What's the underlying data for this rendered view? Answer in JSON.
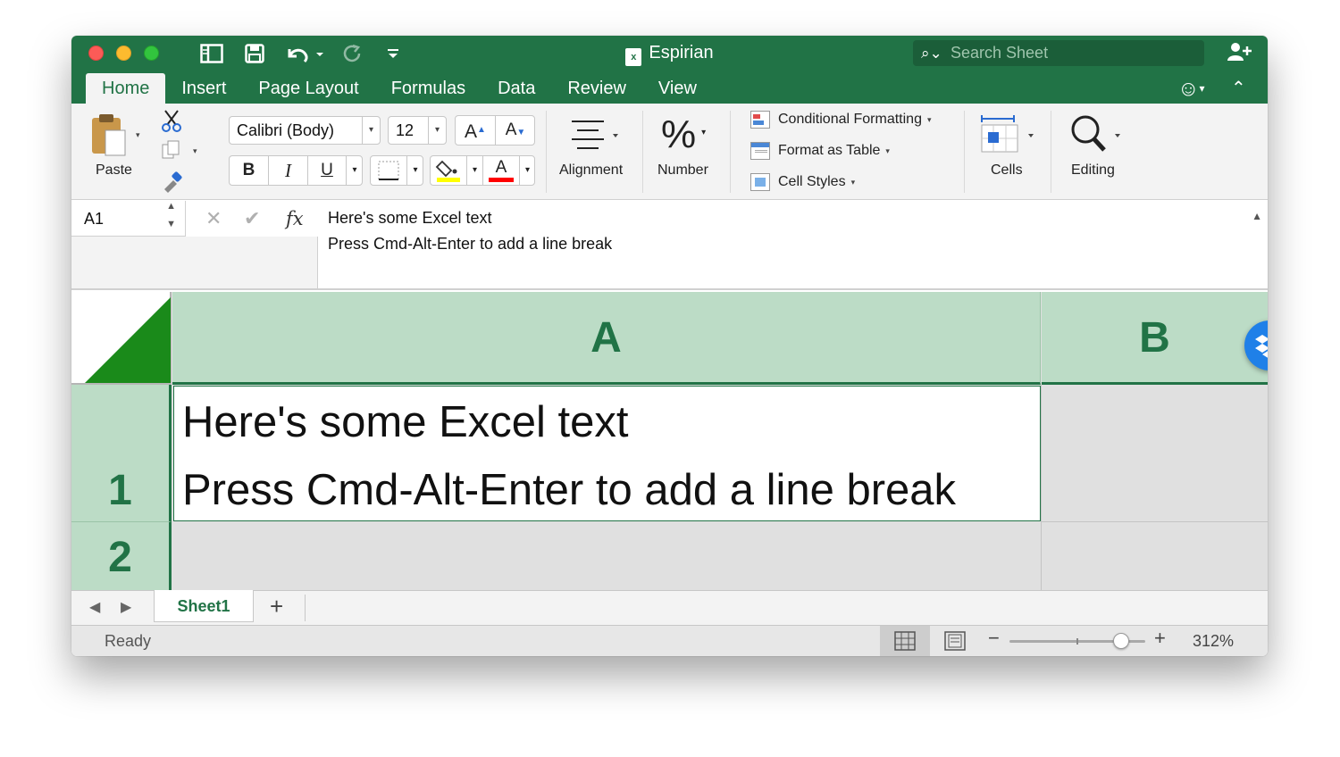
{
  "window": {
    "title": "Espirian"
  },
  "search": {
    "placeholder": "Search Sheet"
  },
  "tabs": [
    "Home",
    "Insert",
    "Page Layout",
    "Formulas",
    "Data",
    "Review",
    "View"
  ],
  "ribbon": {
    "paste_label": "Paste",
    "font_name": "Calibri (Body)",
    "font_size": "12",
    "grow_font": "A",
    "shrink_font": "A",
    "bold": "B",
    "italic": "I",
    "underline": "U",
    "font_color_glyph": "A",
    "alignment_label": "Alignment",
    "number_glyph": "%",
    "number_label": "Number",
    "conditional_formatting": "Conditional Formatting",
    "format_as_table": "Format as Table",
    "cell_styles": "Cell Styles",
    "cells_label": "Cells",
    "editing_label": "Editing",
    "fill_color": "#ffff00",
    "font_color": "#ff0000"
  },
  "formula_bar": {
    "name_box": "A1",
    "fx": "fx",
    "line1": "Here's some Excel text",
    "line2": "Press Cmd-Alt-Enter to add a line break"
  },
  "grid": {
    "columns": [
      "A",
      "B"
    ],
    "rows": [
      "1",
      "2"
    ],
    "a1_line1": "Here's some Excel text",
    "a1_line2": "Press Cmd-Alt-Enter to add a line break"
  },
  "sheets": {
    "active": "Sheet1",
    "add": "+"
  },
  "status": {
    "text": "Ready",
    "zoom": "312%",
    "zoom_level": 0.82
  },
  "colors": {
    "accent": "#217346",
    "header_fill": "#bcdcc6"
  }
}
